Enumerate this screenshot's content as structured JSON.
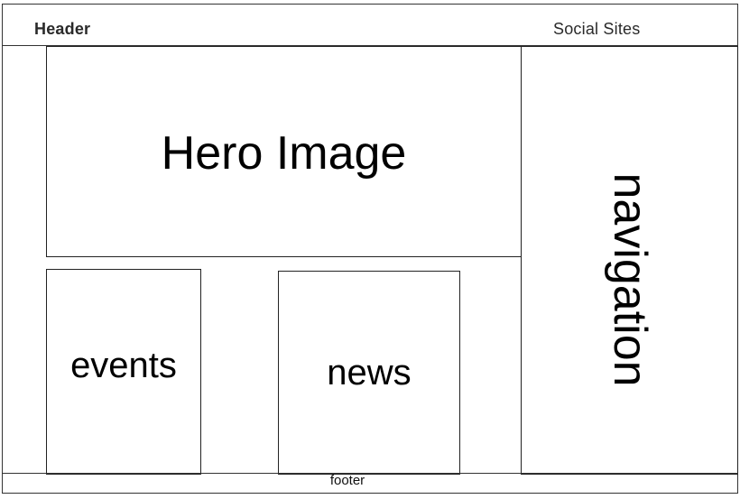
{
  "header": {
    "label": "Header",
    "social_label": "Social Sites"
  },
  "hero": {
    "label": "Hero Image"
  },
  "events": {
    "label": "events"
  },
  "news": {
    "label": "news"
  },
  "navigation": {
    "label": "navigation"
  },
  "footer": {
    "label": "footer"
  }
}
